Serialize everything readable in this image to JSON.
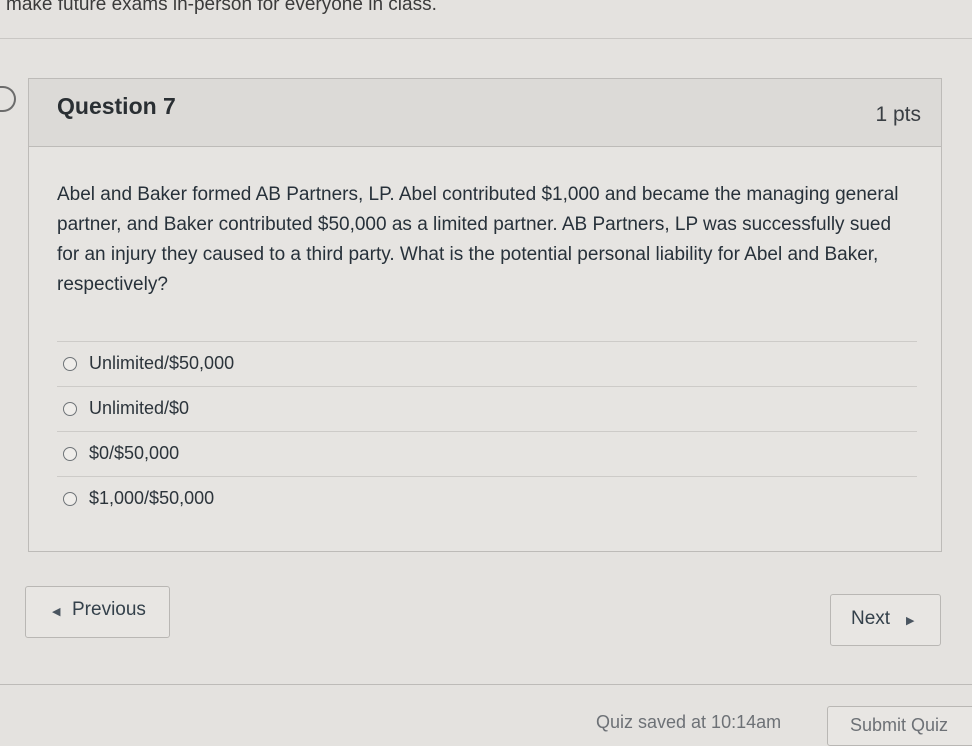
{
  "page": {
    "top_note": "make future exams in-person for everyone in class."
  },
  "question": {
    "title": "Question 7",
    "points": "1 pts",
    "text": "Abel and Baker formed AB Partners, LP. Abel contributed $1,000 and became the managing general partner, and Baker contributed $50,000 as a limited partner. AB Partners, LP was successfully sued for an injury they caused to a third party. What is the potential personal liability for Abel and Baker, respectively?",
    "answers": [
      {
        "label": "Unlimited/$50,000"
      },
      {
        "label": "Unlimited/$0"
      },
      {
        "label": "$0/$50,000"
      },
      {
        "label": "$1,000/$50,000"
      }
    ]
  },
  "navigation": {
    "previous_label": "Previous",
    "previous_icon": "caret-left-icon",
    "next_label": "Next",
    "next_icon": "caret-right-icon"
  },
  "footer": {
    "saved_text": "Quiz saved at 10:14am",
    "submit_label": "Submit Quiz"
  }
}
